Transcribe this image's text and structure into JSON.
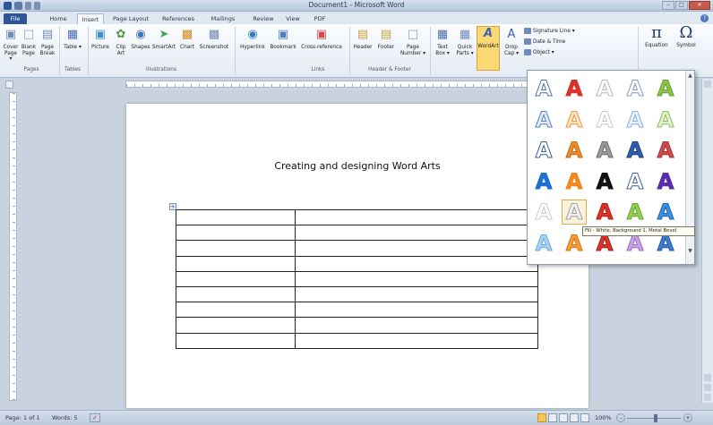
{
  "window": {
    "title": "Document1 - Microsoft Word",
    "controls": [
      "–",
      "□",
      "✕"
    ]
  },
  "tabs": [
    "File",
    "Home",
    "Insert",
    "Page Layout",
    "References",
    "Mailings",
    "Review",
    "View",
    "PDF"
  ],
  "active_tab": "Insert",
  "ribbon": {
    "pages": {
      "label": "Pages",
      "cover_page": "Cover Page ▾",
      "blank_page": "Blank Page",
      "page_break": "Page Break"
    },
    "tables": {
      "label": "Tables",
      "table": "Table ▾"
    },
    "illustrations": {
      "label": "Illustrations",
      "picture": "Picture",
      "clip_art": "Clip Art",
      "shapes": "Shapes",
      "smartart": "SmartArt",
      "chart": "Chart",
      "screenshot": "Screenshot"
    },
    "links": {
      "label": "Links",
      "hyperlink": "Hyperlink",
      "bookmark": "Bookmark",
      "cross_reference": "Cross-reference"
    },
    "header_footer": {
      "label": "Header & Footer",
      "header": "Header",
      "footer": "Footer",
      "page_number": "Page Number ▾"
    },
    "text": {
      "text_box": "Text Box ▾",
      "quick_parts": "Quick Parts ▾",
      "wordart": "WordArt",
      "drop_cap": "Drop Cap ▾",
      "signature_line": "Signature Line ▾",
      "date_time": "Date & Time",
      "object": "Object ▾"
    },
    "symbols": {
      "equation": "Equation",
      "symbol": "Symbol"
    }
  },
  "document": {
    "heading": "Creating and designing Word Arts",
    "table": {
      "rows": 9,
      "cols": 2
    }
  },
  "wordart_gallery": {
    "glyph": "A",
    "styles": [
      [
        {
          "fill": "#ffffff",
          "stroke": "#4f6fae"
        },
        {
          "fill": "#d9342b",
          "stroke": "#d9342b"
        },
        {
          "fill": "#ffffff",
          "stroke": "#b8b8b8"
        },
        {
          "fill": "#ffffff",
          "stroke": "#7f9bc8"
        },
        {
          "fill": "#8bc34a",
          "stroke": "#6a9a32"
        }
      ],
      [
        {
          "fill": "#dfe9f7",
          "stroke": "#5b7fbf"
        },
        {
          "fill": "#ffe2c2",
          "stroke": "#e59a3d"
        },
        {
          "fill": "#ffffff",
          "stroke": "#c9c9c9"
        },
        {
          "fill": "#e8f0fb",
          "stroke": "#8eaee0"
        },
        {
          "fill": "#e1f0cf",
          "stroke": "#8cbf5a"
        }
      ],
      [
        {
          "fill": "#ffffff",
          "stroke": "#3c5f9f"
        },
        {
          "fill": "#ec8b2c",
          "stroke": "#c46b13"
        },
        {
          "fill": "#9a9a9a",
          "stroke": "#6e6e6e"
        },
        {
          "fill": "#2d5fb3",
          "stroke": "#1c3f7c"
        },
        {
          "fill": "#d04b4b",
          "stroke": "#a33030"
        }
      ],
      [
        {
          "fill": "#1f6fd1",
          "stroke": "#1f6fd1"
        },
        {
          "fill": "#ee8a24",
          "stroke": "#ee8a24"
        },
        {
          "fill": "#111111",
          "stroke": "#111111"
        },
        {
          "fill": "#ffffff",
          "stroke": "#3f63a6"
        },
        {
          "fill": "#5a2ea8",
          "stroke": "#5a2ea8"
        }
      ],
      [
        {
          "fill": "#ffffff",
          "stroke": "#c9c9c9"
        },
        {
          "fill": "#f2f2f2",
          "stroke": "#a0a0a0"
        },
        {
          "fill": "#e03127",
          "stroke": "#b01d15"
        },
        {
          "fill": "#8fd14f",
          "stroke": "#6aa631"
        },
        {
          "fill": "#3b8fe0",
          "stroke": "#2264b1"
        }
      ],
      [
        {
          "fill": "#a9d3f5",
          "stroke": "#6aa6d8"
        },
        {
          "fill": "#f49b3b",
          "stroke": "#d47514"
        },
        {
          "fill": "#d9332b",
          "stroke": "#a11c15"
        },
        {
          "fill": "#c9a3e6",
          "stroke": "#9a6bc4"
        },
        {
          "fill": "#3f7bd1",
          "stroke": "#2554a0"
        }
      ]
    ],
    "hover_tooltip": "Fill - White, Background 1, Metal Bevel"
  },
  "status": {
    "page": "Page: 1 of 1",
    "words": "Words: 5",
    "zoom": "100%"
  }
}
